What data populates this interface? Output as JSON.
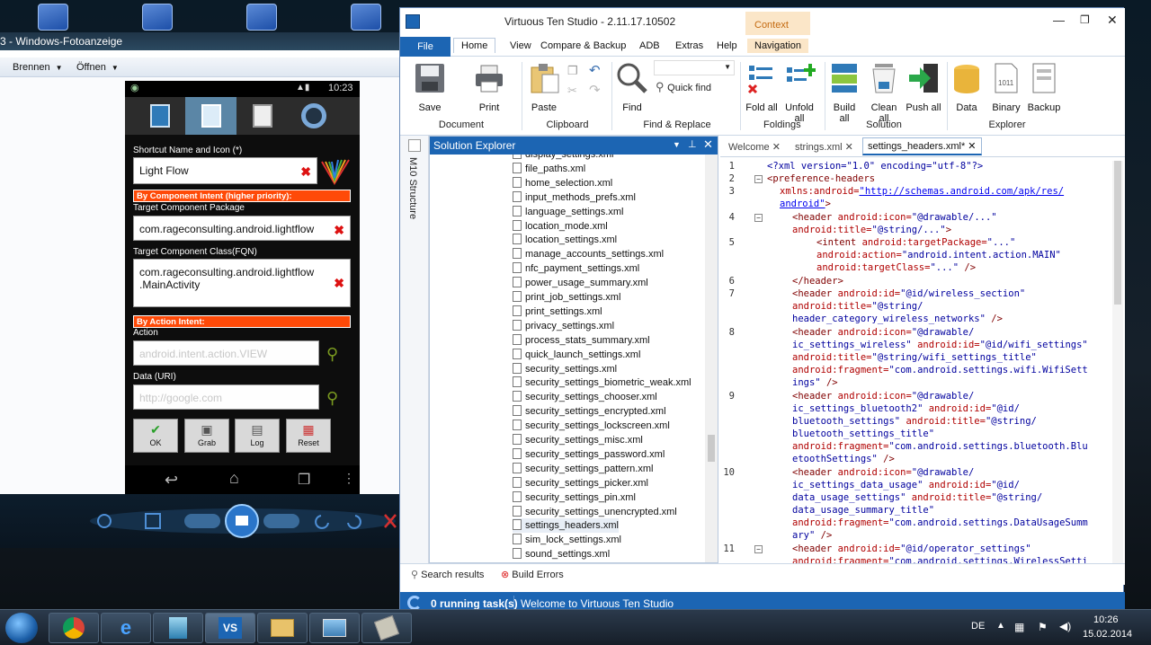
{
  "viewer": {
    "title": "3 - Windows-Fotoanzeige",
    "menu_burn": "Brennen",
    "menu_open": "Öffnen"
  },
  "phone": {
    "time": "10:23",
    "shortcut_label": "Shortcut Name and Icon (*)",
    "shortcut_value": "Light Flow",
    "section_component": "By Component Intent (higher priority):",
    "package_label": "Target Component Package",
    "package_value": "com.rageconsulting.android.lightflow",
    "class_label": "Target Component Class(FQN)",
    "class_value_1": "com.rageconsulting.android.lightflow",
    "class_value_2": ".MainActivity",
    "section_action": "By Action Intent:",
    "action_label": "Action",
    "action_placeholder": "android.intent.action.VIEW",
    "data_label": "Data (URI)",
    "data_placeholder": "http://google.com",
    "buttons": {
      "ok": "OK",
      "grab": "Grab",
      "log": "Log",
      "reset": "Reset"
    }
  },
  "vts": {
    "title": "Virtuous Ten Studio - 2.11.17.10502",
    "context": "Context",
    "ribbon_tabs": [
      "File",
      "Home",
      "View",
      "Compare & Backup",
      "ADB",
      "Extras",
      "Help",
      "Navigation"
    ],
    "ribbon": {
      "save": "Save",
      "print": "Print",
      "paste": "Paste",
      "find": "Find",
      "quick_find": "Quick find",
      "fold_all": "Fold all",
      "unfold_all_1": "Unfold",
      "unfold_all_2": "all",
      "build_all_1": "Build",
      "build_all_2": "all",
      "clean_all_1": "Clean",
      "clean_all_2": "all",
      "push_all": "Push all",
      "data": "Data",
      "binary": "Binary",
      "backup": "Backup",
      "groups": {
        "document": "Document",
        "clipboard": "Clipboard",
        "find_replace": "Find & Replace",
        "foldings": "Foldings",
        "solution": "Solution",
        "explorer": "Explorer"
      }
    },
    "side_strip": "M10 Structure",
    "solution_explorer": {
      "title": "Solution Explorer",
      "files": [
        "display_settings.xml",
        "file_paths.xml",
        "home_selection.xml",
        "input_methods_prefs.xml",
        "language_settings.xml",
        "location_mode.xml",
        "location_settings.xml",
        "manage_accounts_settings.xml",
        "nfc_payment_settings.xml",
        "power_usage_summary.xml",
        "print_job_settings.xml",
        "print_settings.xml",
        "privacy_settings.xml",
        "process_stats_summary.xml",
        "quick_launch_settings.xml",
        "security_settings.xml",
        "security_settings_biometric_weak.xml",
        "security_settings_chooser.xml",
        "security_settings_encrypted.xml",
        "security_settings_lockscreen.xml",
        "security_settings_misc.xml",
        "security_settings_password.xml",
        "security_settings_pattern.xml",
        "security_settings_picker.xml",
        "security_settings_pin.xml",
        "security_settings_unencrypted.xml",
        "settings_headers.xml",
        "sim_lock_settings.xml",
        "sound_settings.xml"
      ]
    },
    "editor_tabs": [
      "Welcome",
      "strings.xml",
      "settings_headers.xml*"
    ],
    "line_numbers": [
      "1",
      "2",
      "3",
      "4",
      "5",
      "6",
      "7",
      "8",
      "9",
      "10",
      "11"
    ],
    "bottom_tabs": {
      "search": "Search results",
      "build_errors": "Build Errors"
    },
    "status": {
      "tasks": "0 running task(s)",
      "message": "Welcome to Virtuous Ten Studio"
    }
  },
  "code": {
    "l1": "<?xml version=\"1.0\" encoding=\"utf-8\"?>",
    "l2": "<preference-headers",
    "l3a": "xmlns:android=",
    "l3b": "\"http://schemas.android.com/apk/res/",
    "l3c": "android\"",
    "l3d": ">",
    "l4a": "<header",
    "l4b": "android:icon=",
    "l4c": "\"@drawable/...\"",
    "l4d": "android:title=",
    "l4e": "\"@string/...\"",
    "l4f": ">",
    "l5a": "<intent",
    "l5b": "android:targetPackage=",
    "l5c": "\"...\"",
    "l5d": "android:action=",
    "l5e": "\"android.intent.action.MAIN\"",
    "l5f": "android:targetClass=",
    "l5g": "\"...\"",
    "l5h": "/>",
    "l6": "</header>",
    "l7a": "<header",
    "l7b": "android:id=",
    "l7c": "\"@id/wireless_section\"",
    "l7d": "android:title=",
    "l7e": "\"@string/",
    "l7f": "header_category_wireless_networks\"",
    "l7g": "/>",
    "l8a": "<header",
    "l8b": "android:icon=",
    "l8c": "\"@drawable/",
    "l8d": "ic_settings_wireless\"",
    "l8e": "android:id=",
    "l8f": "\"@id/wifi_settings\"",
    "l8g": "android:title=",
    "l8h": "\"@string/wifi_settings_title\"",
    "l8i": "android:fragment=",
    "l8j": "\"com.android.settings.wifi.WifiSett",
    "l8k": "ings\"",
    "l8l": "/>",
    "l9a": "<header",
    "l9b": "android:icon=",
    "l9c": "\"@drawable/",
    "l9d": "ic_settings_bluetooth2\"",
    "l9e": "android:id=",
    "l9f": "\"@id/",
    "l9g": "bluetooth_settings\"",
    "l9h": "android:title=",
    "l9i": "\"@string/",
    "l9j": "bluetooth_settings_title\"",
    "l9k": "android:fragment=",
    "l9l": "\"com.android.settings.bluetooth.Blu",
    "l9m": "etoothSettings\"",
    "l9n": "/>",
    "l10a": "<header",
    "l10b": "android:icon=",
    "l10c": "\"@drawable/",
    "l10d": "ic_settings_data_usage\"",
    "l10e": "android:id=",
    "l10f": "\"@id/",
    "l10g": "data_usage_settings\"",
    "l10h": "android:title=",
    "l10i": "\"@string/",
    "l10j": "data_usage_summary_title\"",
    "l10k": "android:fragment=",
    "l10l": "\"com.android.settings.DataUsageSumm",
    "l10m": "ary\"",
    "l10n": "/>",
    "l11a": "<header",
    "l11b": "android:id=",
    "l11c": "\"@id/operator_settings\"",
    "l11d": "android:fragment=",
    "l11e": "\"com.android.settings.WirelessSetti"
  },
  "taskbar": {
    "lang": "DE",
    "time": "10:26",
    "date": "15.02.2014"
  }
}
